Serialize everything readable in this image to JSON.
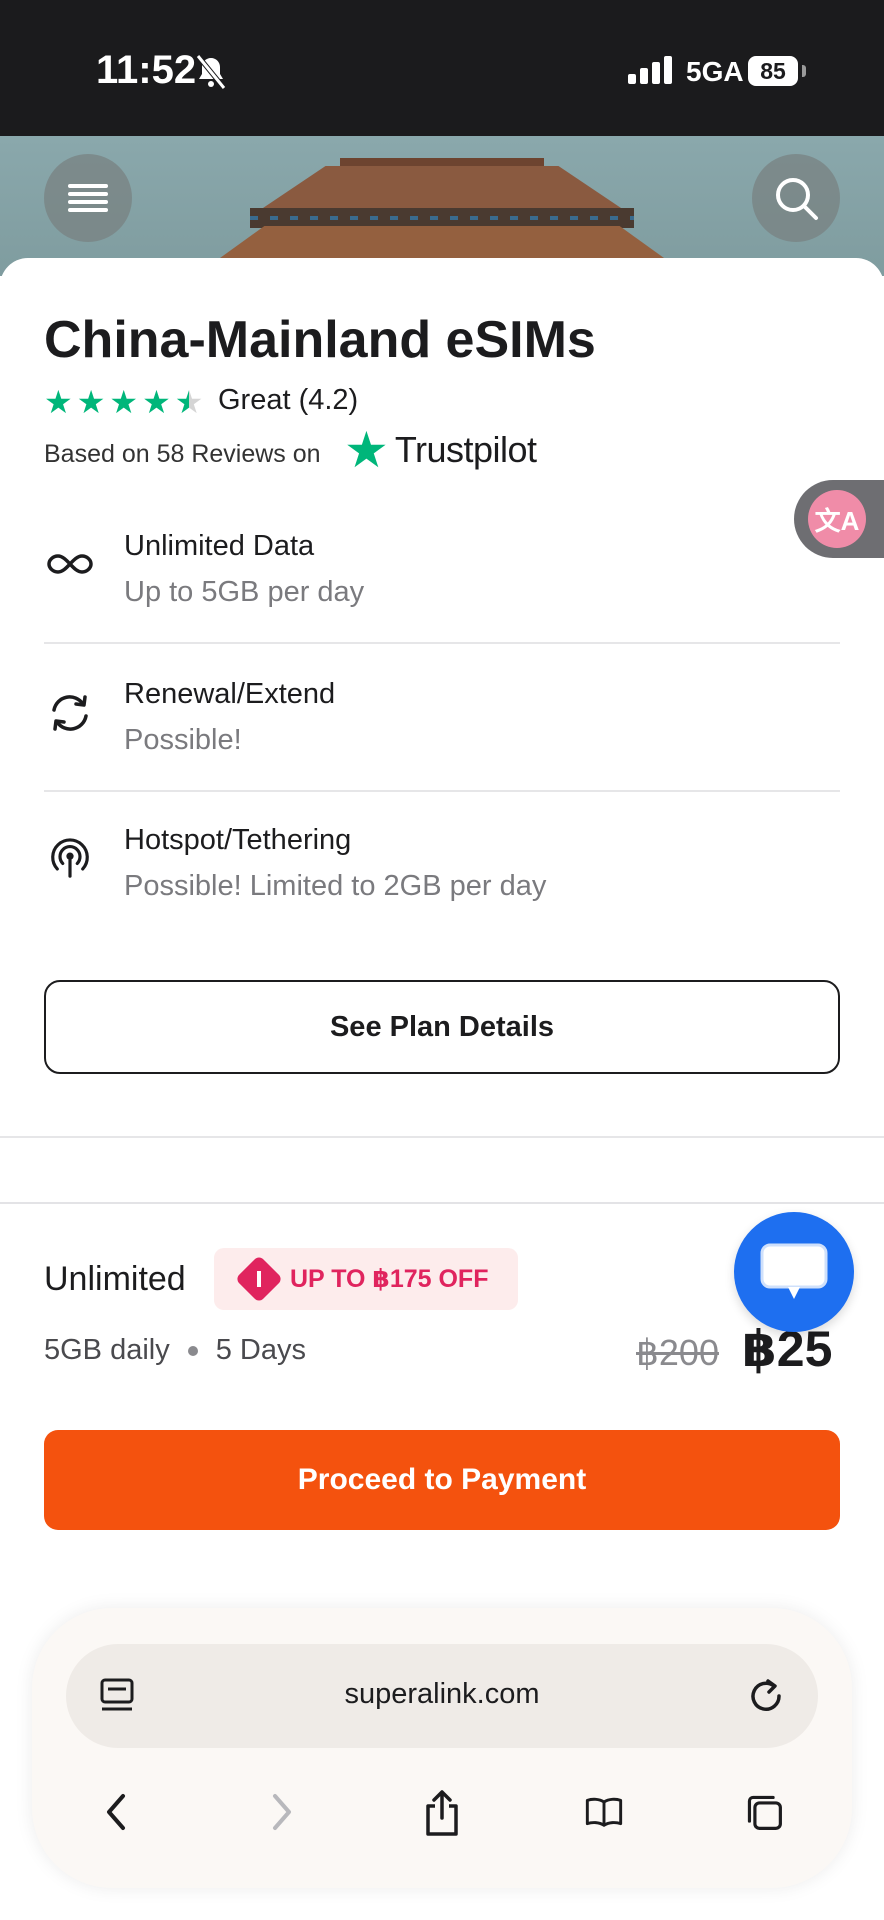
{
  "status_bar": {
    "time": "11:52",
    "network": "5GA",
    "battery": "85"
  },
  "header": {
    "menu_icon": "menu-icon",
    "search_icon": "search-icon"
  },
  "product": {
    "title": "China-Mainland eSIMs",
    "rating_label": "Great (4.2)",
    "rating_value": 4.2,
    "reviews_text": "Based on 58 Reviews on",
    "trustpilot": "Trustpilot"
  },
  "features": [
    {
      "title": "Unlimited Data",
      "subtitle": "Up to 5GB per day",
      "icon": "infinity-icon"
    },
    {
      "title": "Renewal/Extend",
      "subtitle": "Possible!",
      "icon": "refresh-icon"
    },
    {
      "title": "Hotspot/Tethering",
      "subtitle": "Possible! Limited to 2GB per day",
      "icon": "hotspot-icon"
    }
  ],
  "plan_details_label": "See Plan Details",
  "purchase": {
    "plan_name": "Unlimited",
    "discount_badge": "UP TO ฿175 OFF",
    "data_daily": "5GB daily",
    "duration": "5 Days",
    "old_price": "฿200",
    "new_price": "฿25",
    "pay_label": "Proceed to Payment"
  },
  "browser": {
    "url": "superalink.com"
  },
  "colors": {
    "accent": "#f4520e",
    "trustpilot": "#00b67a",
    "discount": "#e0245e",
    "chat": "#1e6ff0"
  }
}
